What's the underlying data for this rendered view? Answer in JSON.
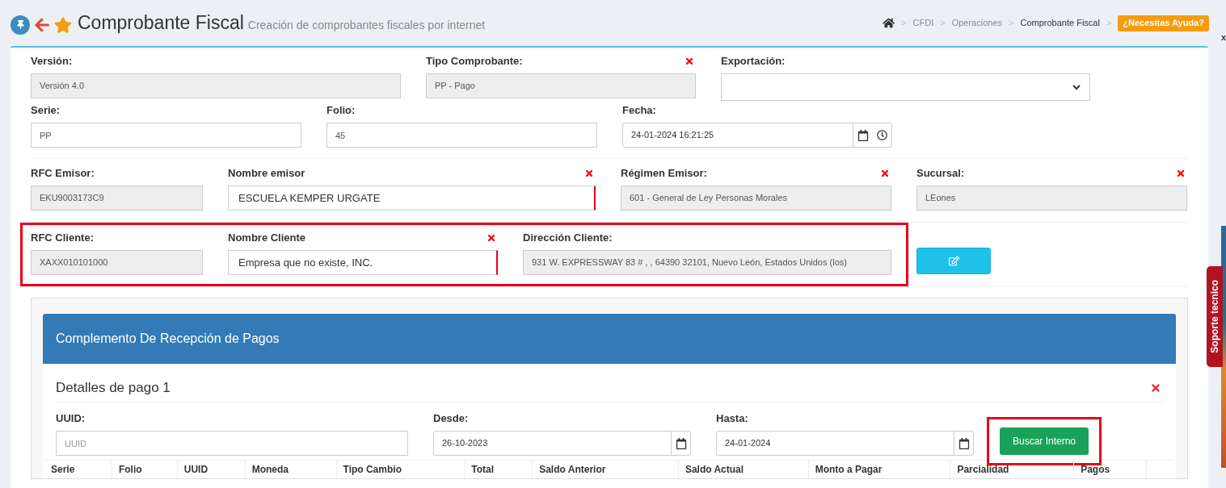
{
  "header": {
    "title": "Comprobante Fiscal",
    "subtitle": "Creación de comprobantes fiscales por internet",
    "separator": ">",
    "breadcrumbs": [
      {
        "label": "CFDI",
        "current": false
      },
      {
        "label": "Operaciones",
        "current": false
      },
      {
        "label": "Comprobante Fiscal",
        "current": true
      }
    ],
    "help_button": "¿Necesitas Ayuda?"
  },
  "close_mark": "x",
  "support_tab": "Soporte tecnico",
  "form_rows": [
    {
      "fields": [
        {
          "label": "Versión:",
          "kind": "readonly",
          "value": "Versión 4.0",
          "required": false,
          "error_bar": false
        },
        {
          "label": "Tipo Comprobante:",
          "kind": "readonly",
          "value": "PP - Pago",
          "required": true,
          "error_bar": false
        },
        {
          "label": "Exportación:",
          "kind": "select",
          "required": false,
          "error_bar": false
        }
      ]
    },
    {
      "fields": [
        {
          "label": "Serie:",
          "kind": "text",
          "value": "PP",
          "required": false,
          "error_bar": false
        },
        {
          "label": "Folio:",
          "kind": "text",
          "value": "45",
          "required": false,
          "error_bar": false
        },
        {
          "label": "Fecha:",
          "kind": "datetime",
          "value": "24-01-2024 16:21:25",
          "required": false,
          "error_bar": false
        }
      ]
    },
    {
      "fields": [
        {
          "label": "RFC Emisor:",
          "kind": "readonly",
          "value": "EKU9003173C9",
          "required": false,
          "error_bar": false
        },
        {
          "label": "Nombre emisor",
          "kind": "large",
          "value": "ESCUELA KEMPER URGATE",
          "required": true,
          "error_bar": true
        },
        {
          "label": "Régimen Emisor:",
          "kind": "readonly",
          "value": "601 - General de Ley Personas Morales",
          "required": true,
          "error_bar": false
        },
        {
          "label": "Sucursal:",
          "kind": "readonly",
          "value": "LEones",
          "required": true,
          "error_bar": false
        }
      ]
    }
  ],
  "client": {
    "highlighted": true,
    "fields": [
      {
        "label": "RFC Cliente:",
        "kind": "readonly",
        "value": "XAXX010101000",
        "required": false,
        "error_bar": false
      },
      {
        "label": "Nombre Cliente",
        "kind": "large",
        "value": "Empresa que no existe, INC.",
        "required": true,
        "error_bar": true
      },
      {
        "label": "Dirección Cliente:",
        "kind": "readonly",
        "value": "931 W. EXPRESSWAY 83 # , , 64390 32101, Nuevo León, Estados Unidos (los)",
        "required": false,
        "error_bar": false
      }
    ]
  },
  "payment_panel": {
    "title": "Complemento De Recepción de Pagos",
    "details": [
      {
        "title": "Detalles de pago 1",
        "removable": true,
        "fields": [
          {
            "label": "UUID:",
            "kind": "text",
            "placeholder": "UUID",
            "required": false,
            "error_bar": false
          },
          {
            "label": "Desde:",
            "kind": "date",
            "value": "26-10-2023",
            "required": false,
            "error_bar": false
          },
          {
            "label": "Hasta:",
            "kind": "date",
            "value": "24-01-2024",
            "required": false,
            "error_bar": false
          }
        ],
        "search_button": {
          "label": "Buscar Interno",
          "highlighted": true
        },
        "table_columns": [
          "Serie",
          "Folio",
          "UUID",
          "Moneda",
          "Tipo Cambio",
          "Total",
          "Saldo Anterior",
          "Saldo Actual",
          "Monto a Pagar",
          "Parcialidad",
          "Pagos",
          ""
        ]
      }
    ]
  }
}
